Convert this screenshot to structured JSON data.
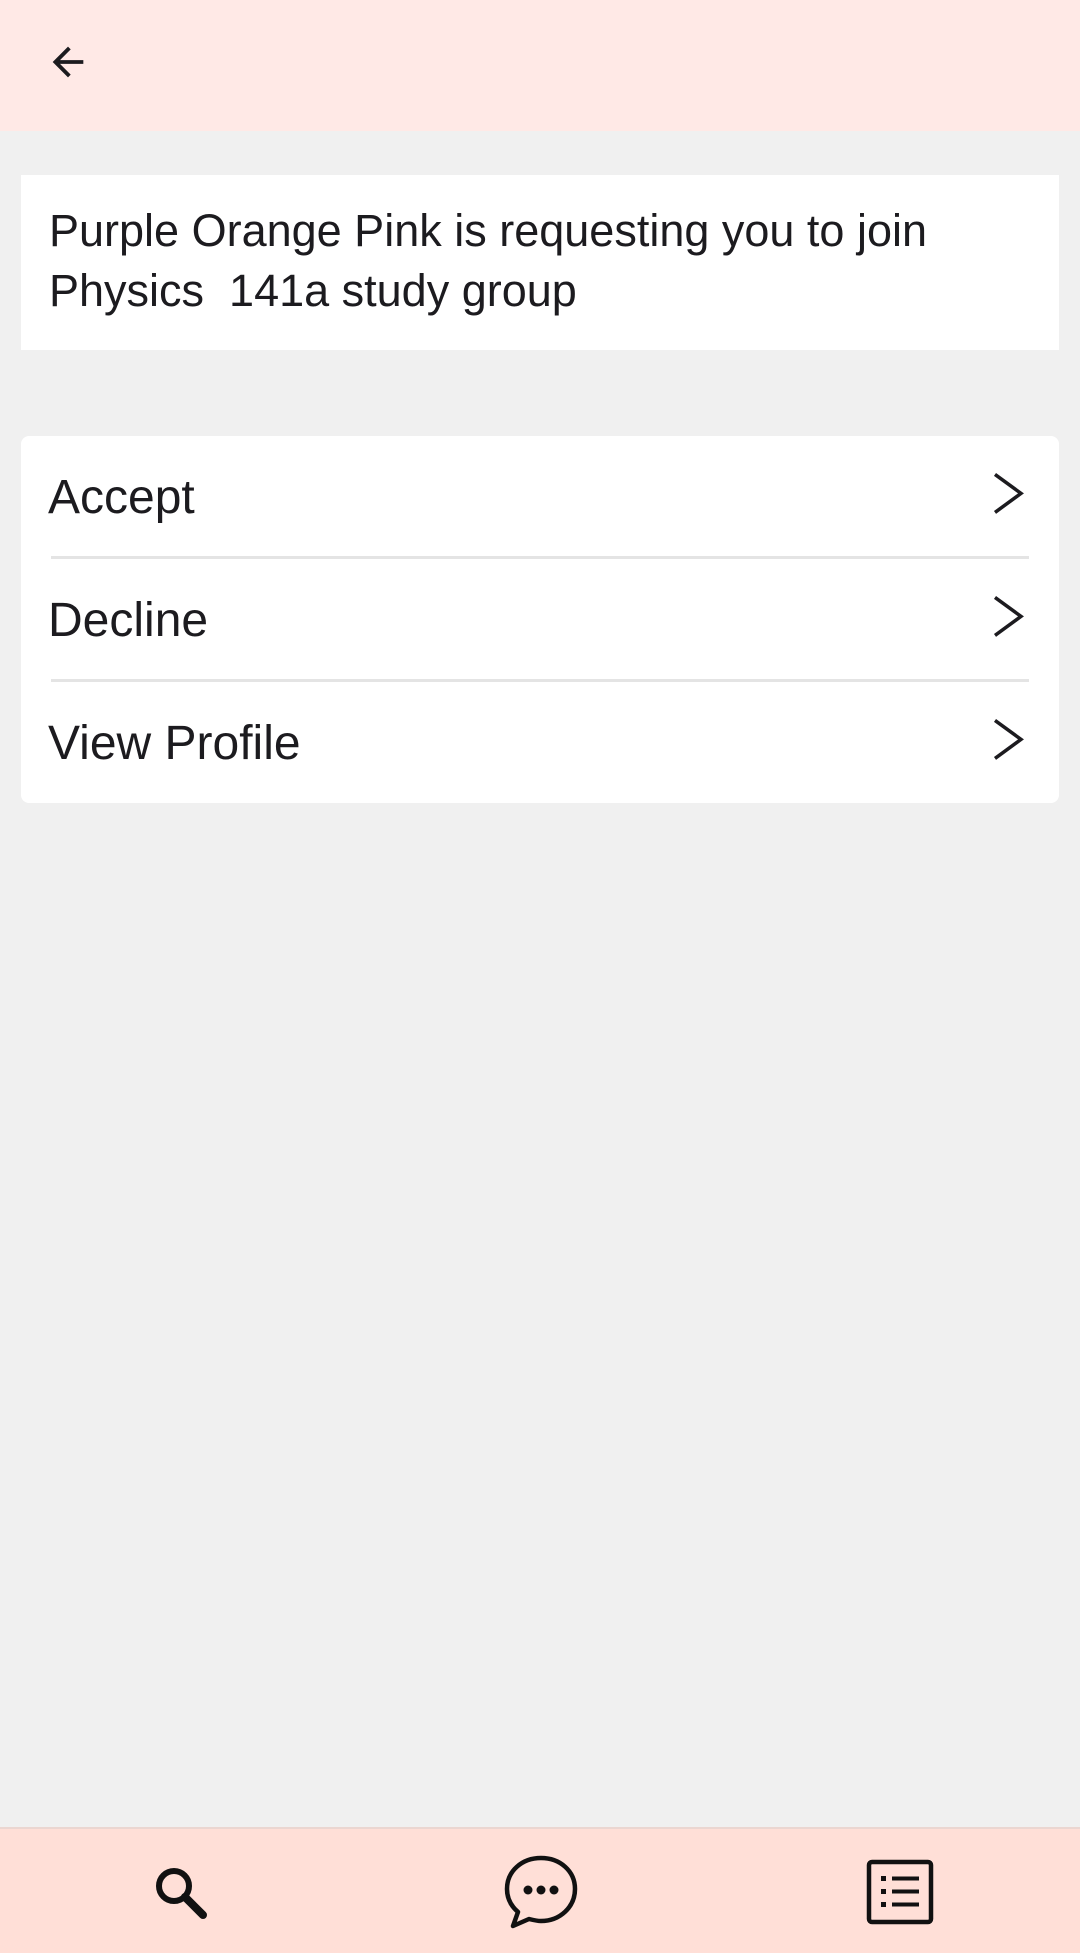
{
  "header": {
    "back_icon": "arrow-left-icon"
  },
  "request": {
    "message": "Purple Orange Pink is requesting you to join\nPhysics  141a study group"
  },
  "options": [
    {
      "label": "Accept",
      "icon": "chevron-right-icon"
    },
    {
      "label": "Decline",
      "icon": "chevron-right-icon"
    },
    {
      "label": "View Profile",
      "icon": "chevron-right-icon"
    }
  ],
  "bottom_nav": [
    {
      "icon": "search-icon"
    },
    {
      "icon": "chat-bubble-icon"
    },
    {
      "icon": "list-icon"
    }
  ],
  "colors": {
    "top_bar": "#ffe9e6",
    "bottom_bar": "#ffdfd7",
    "background": "#f0f0f0",
    "text": "#1c1b1f"
  }
}
